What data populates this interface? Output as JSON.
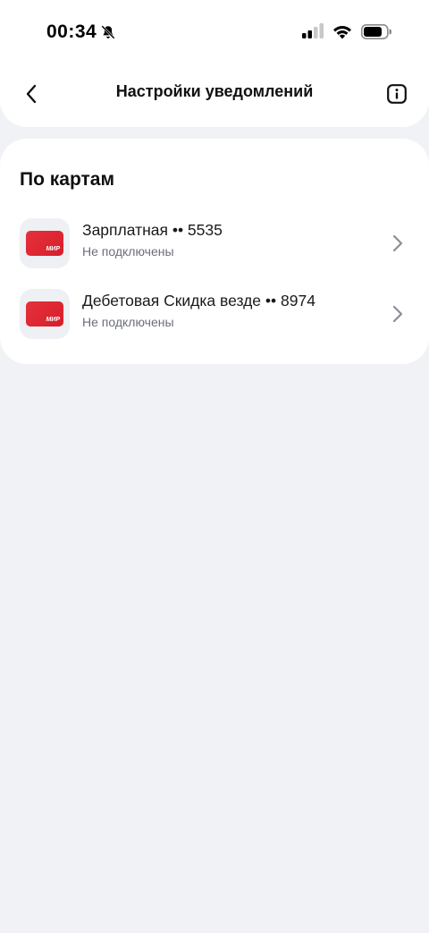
{
  "status_bar": {
    "time": "00:34"
  },
  "header": {
    "title": "Настройки уведомлений"
  },
  "cards_section": {
    "title": "По картам",
    "cards": [
      {
        "name": "Зарплатная •• 5535",
        "status": "Не подключены",
        "brand": "МИР"
      },
      {
        "name": "Дебетовая Скидка везде •• 8974",
        "status": "Не подключены",
        "brand": "МИР"
      }
    ]
  },
  "colors": {
    "background": "#f1f2f6",
    "surface": "#ffffff",
    "card_red": "#e3202c",
    "secondary_text": "#6b6f78",
    "chevron": "#8a8e96"
  },
  "icons": {
    "back": "chevron-left-icon",
    "info": "info-icon",
    "row_arrow": "chevron-right-icon",
    "mute": "bell-slash-icon",
    "signal": "cellular-signal-icon",
    "wifi": "wifi-icon",
    "battery": "battery-icon"
  }
}
